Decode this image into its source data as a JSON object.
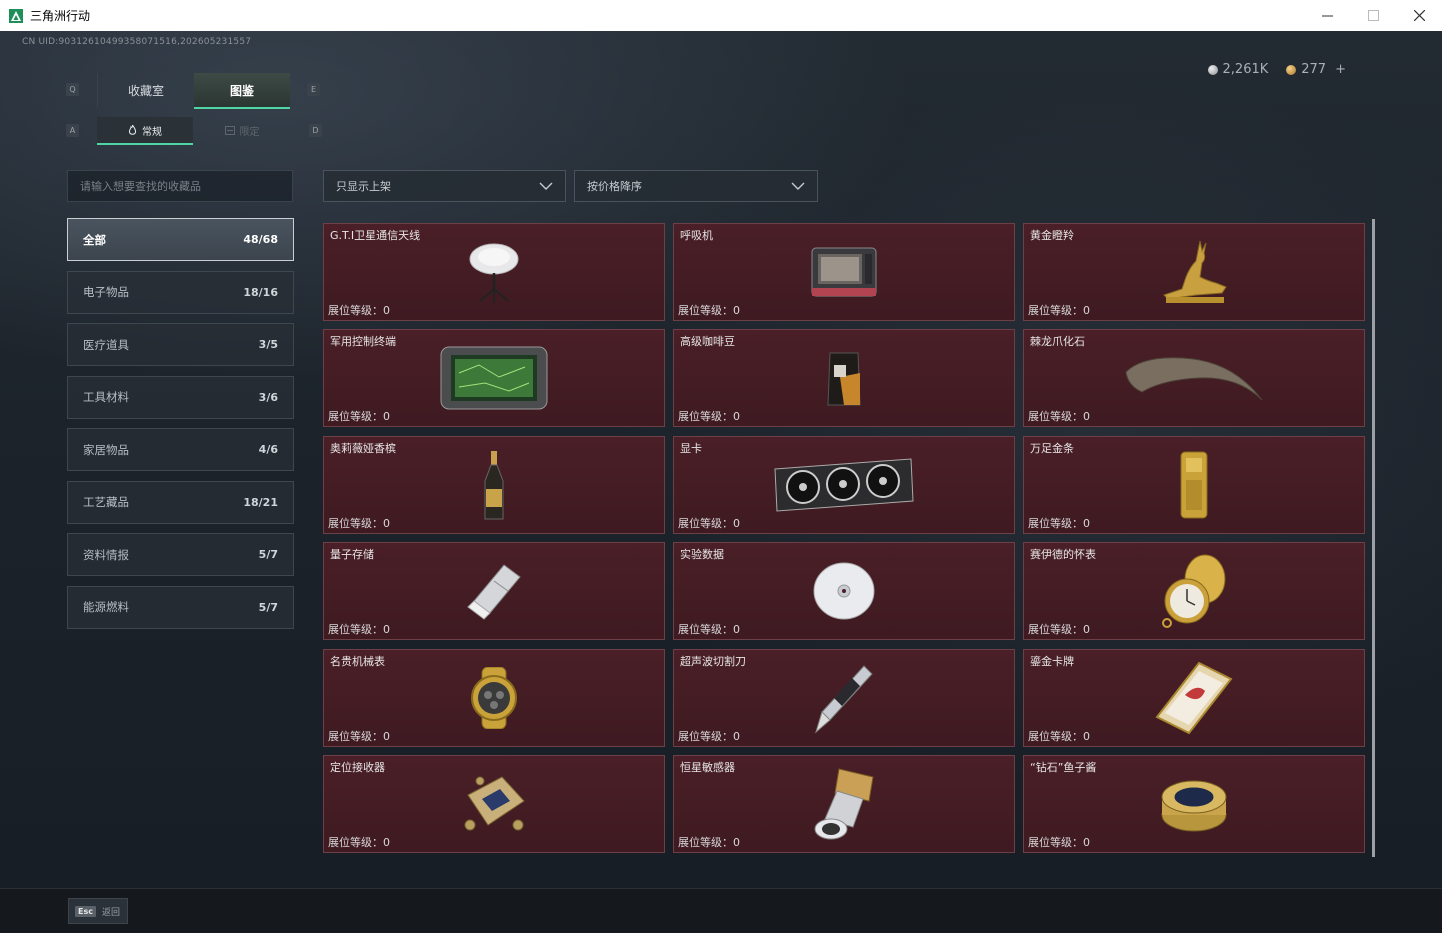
{
  "window": {
    "title": "三角洲行动"
  },
  "header": {
    "uid": "CN UID:9031261049935807151​6,202605231557",
    "currency_silver": "2,261K",
    "currency_gold": "277",
    "currency_add": "+"
  },
  "keys": {
    "tab_prev": "Q",
    "tab_next": "E",
    "sub_prev": "A",
    "sub_next": "D"
  },
  "tabs": [
    {
      "label": "收藏室",
      "active": false
    },
    {
      "label": "图鉴",
      "active": true
    }
  ],
  "subtabs": [
    {
      "label": "常规",
      "active": true
    },
    {
      "label": "限定",
      "active": false
    }
  ],
  "search": {
    "placeholder": "请输入想要查找的收藏品",
    "value": ""
  },
  "categories": [
    {
      "label": "全部",
      "count": "48/68",
      "active": true
    },
    {
      "label": "电子物品",
      "count": "18/16"
    },
    {
      "label": "医疗道具",
      "count": "3/5"
    },
    {
      "label": "工具材料",
      "count": "3/6"
    },
    {
      "label": "家居物品",
      "count": "4/6"
    },
    {
      "label": "工艺藏品",
      "count": "18/21"
    },
    {
      "label": "资料情报",
      "count": "5/7"
    },
    {
      "label": "能源燃料",
      "count": "5/7"
    }
  ],
  "filters": {
    "show_filter": "只显示上架",
    "sort": "按价格降序"
  },
  "level_label": "展位等级：",
  "items": [
    {
      "name": "G.T.I卫星通信天线",
      "level": "0",
      "icon": "satellite-dish-icon"
    },
    {
      "name": "呼吸机",
      "level": "0",
      "icon": "ventilator-icon"
    },
    {
      "name": "黄金瞪羚",
      "level": "0",
      "icon": "golden-gazelle-icon"
    },
    {
      "name": "军用控制终端",
      "level": "0",
      "icon": "control-terminal-icon"
    },
    {
      "name": "高级咖啡豆",
      "level": "0",
      "icon": "coffee-bag-icon"
    },
    {
      "name": "棘龙爪化石",
      "level": "0",
      "icon": "claw-fossil-icon"
    },
    {
      "name": "奥莉薇娅香槟",
      "level": "0",
      "icon": "champagne-bottle-icon"
    },
    {
      "name": "显卡",
      "level": "0",
      "icon": "graphics-card-icon"
    },
    {
      "name": "万足金条",
      "level": "0",
      "icon": "gold-bar-icon"
    },
    {
      "name": "量子存储",
      "level": "0",
      "icon": "usb-drive-icon"
    },
    {
      "name": "实验数据",
      "level": "0",
      "icon": "data-disc-icon"
    },
    {
      "name": "赛伊德的怀表",
      "level": "0",
      "icon": "pocket-watch-icon"
    },
    {
      "name": "名贵机械表",
      "level": "0",
      "icon": "wristwatch-icon"
    },
    {
      "name": "超声波切割刀",
      "level": "0",
      "icon": "ultrasonic-cutter-icon"
    },
    {
      "name": "鎏金卡牌",
      "level": "0",
      "icon": "gilded-card-icon"
    },
    {
      "name": "定位接收器",
      "level": "0",
      "icon": "gps-receiver-icon"
    },
    {
      "name": "恒星敏感器",
      "level": "0",
      "icon": "star-sensor-icon"
    },
    {
      "name": "“钻石”鱼子酱",
      "level": "0",
      "icon": "caviar-tin-icon"
    }
  ],
  "footer": {
    "esc_key": "Esc",
    "esc_label": "返回"
  }
}
